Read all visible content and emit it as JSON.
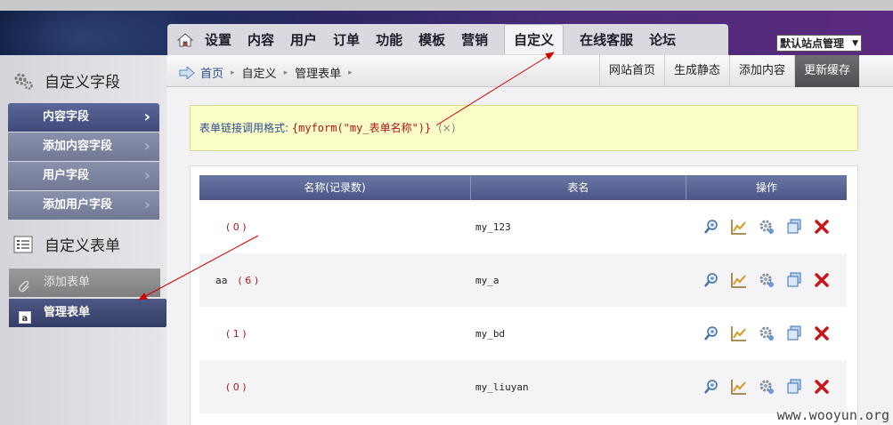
{
  "header": {
    "nav_items": [
      "设置",
      "内容",
      "用户",
      "订单",
      "功能",
      "模板",
      "营销",
      "自定义",
      "在线客服",
      "论坛"
    ],
    "active_item": "自定义",
    "site_select_value": "默认站点管理"
  },
  "sidebar": {
    "section1_title": "自定义字段",
    "section1_items": [
      "内容字段",
      "添加内容字段",
      "用户字段",
      "添加用户字段"
    ],
    "section2_title": "自定义表单",
    "add_form_label": "添加表单",
    "manage_form_label": "管理表单"
  },
  "breadcrumb": {
    "home": "首页",
    "level1": "自定义",
    "level2": "管理表单"
  },
  "actions": [
    "网站首页",
    "生成静态",
    "添加内容",
    "更新缓存"
  ],
  "notice": {
    "label": "表单链接调用格式:",
    "code": "{myform(\"my_表单名称\")}",
    "close": "(×)"
  },
  "table": {
    "headers": [
      "名称(记录数)",
      "表名",
      "操作"
    ],
    "rows": [
      {
        "name": "",
        "count": "( 0 )",
        "table": "my_123"
      },
      {
        "name": "aa",
        "count": "( 6 )",
        "table": "my_a"
      },
      {
        "name": "",
        "count": "( 1 )",
        "table": "my_bd"
      },
      {
        "name": "",
        "count": "( 0 )",
        "table": "my_liuyan"
      }
    ]
  },
  "watermark": "www.wooyun.org",
  "colors": {
    "nav_bg": "#d9d9df",
    "sidebar_active": "#3f4a7a",
    "notice_bg": "#fbfdc8",
    "code_red": "#b0151c",
    "annotation_arrow": "#d40000"
  },
  "icons": {
    "ops": [
      "magnifier-icon",
      "chart-edit-icon",
      "gear-icon",
      "copy-icon",
      "delete-icon"
    ]
  }
}
